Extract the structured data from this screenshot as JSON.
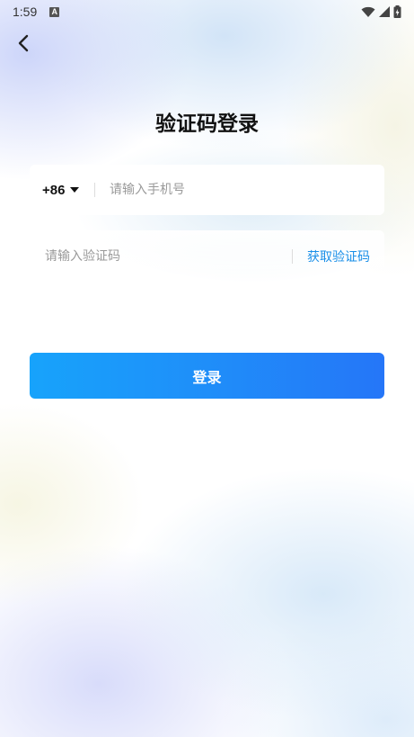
{
  "status_bar": {
    "time": "1:59",
    "notification_icon_label": "A",
    "icons": [
      "wifi-icon",
      "cell-signal-icon",
      "battery-icon"
    ]
  },
  "header": {
    "back_icon": "chevron-left-icon",
    "title": "验证码登录"
  },
  "phone_field": {
    "country_code": "+86",
    "placeholder": "请输入手机号",
    "value": ""
  },
  "code_field": {
    "placeholder": "请输入验证码",
    "value": "",
    "get_code_label": "获取验证码"
  },
  "login_button": {
    "label": "登录"
  },
  "colors": {
    "accent": "#1a8fe8",
    "button_gradient_start": "#17a3fb",
    "button_gradient_end": "#2576f8"
  }
}
